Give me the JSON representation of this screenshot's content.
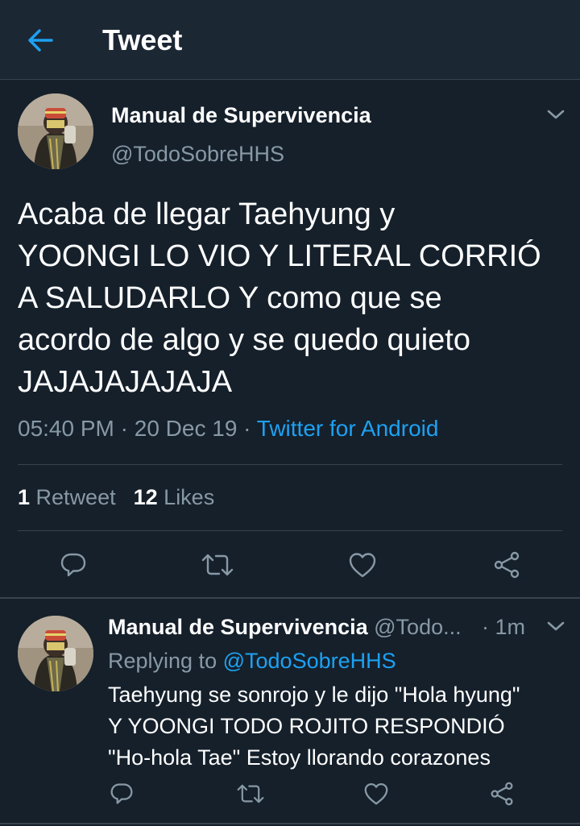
{
  "header": {
    "title": "Tweet",
    "back_icon": "arrow-left-icon",
    "accent": "#1da1f2"
  },
  "tweet": {
    "author_name": "Manual de Supervivencia",
    "author_handle": "@TodoSobreHHS",
    "text_lines": [
      "Acaba de llegar Taehyung y",
      "YOONGI LO VIO Y LITERAL CORRIÓ",
      "A SALUDARLO Y como que se",
      "acordo de algo y se quedo quieto",
      "JAJAJAJAJAJA"
    ],
    "time": "05:40 PM",
    "date": "20 Dec 19",
    "source": "Twitter for Android",
    "retweets_count": "1",
    "retweets_label": "Retweet",
    "likes_count": "12",
    "likes_label": "Likes",
    "actions": [
      "reply-icon",
      "retweet-icon",
      "like-icon",
      "share-icon"
    ]
  },
  "reply": {
    "author_name": "Manual de Supervivencia",
    "author_handle": "@Todo...",
    "time": "· 1m",
    "replying_prefix": "Replying to",
    "replying_handle": "@TodoSobreHHS",
    "text_lines": [
      "Taehyung se sonrojo y le dijo \"Hola hyung\"",
      "Y YOONGI TODO ROJITO RESPONDIÓ",
      "\"Ho-hola Tae\" Estoy llorando corazones"
    ],
    "actions": [
      "reply-icon",
      "retweet-icon",
      "like-icon",
      "share-icon"
    ]
  },
  "colors": {
    "background": "#15202b",
    "header_bg": "#1c2734",
    "muted_text": "#8899a6",
    "divider": "#38444d",
    "link": "#1da1f2"
  }
}
